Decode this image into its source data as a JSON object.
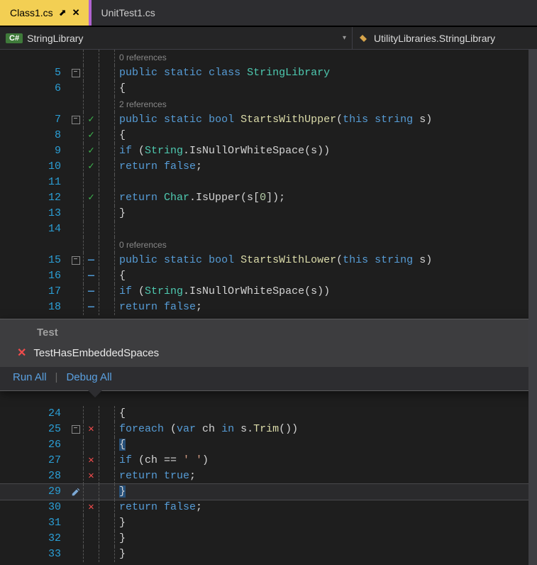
{
  "tabs": [
    {
      "label": "Class1.cs",
      "active": true,
      "pinned": true
    },
    {
      "label": "UnitTest1.cs",
      "active": false,
      "pinned": false
    }
  ],
  "breadcrumb": {
    "language_badge": "C#",
    "left": "StringLibrary",
    "right": "UtilityLibraries.StringLibrary"
  },
  "references": {
    "zero": "0 references",
    "two": "2 references"
  },
  "code": {
    "l5": "public static class StringLibrary",
    "l6": "{",
    "l7a": "public static bool ",
    "l7b": "StartsWithUpper",
    "l7c": "(this string s)",
    "l8": "{",
    "l9a": "if (",
    "l9b": "String",
    "l9c": ".IsNullOrWhiteSpace(s))",
    "l10": "return false;",
    "l12a": "return ",
    "l12b": "Char",
    "l12c": ".IsUpper(s[0]);",
    "l13": "}",
    "l15a": "public static bool ",
    "l15b": "StartsWithLower",
    "l15c": "(this string s)",
    "l16": "{",
    "l17a": "if (",
    "l17b": "String",
    "l17c": ".IsNullOrWhiteSpace(s))",
    "l18": "return false;",
    "l24": "{",
    "l25a": "foreach (var ch in s.",
    "l25b": "Trim",
    "l25c": "())",
    "l26": "{",
    "l27": "if (ch == ' ')",
    "l28": "return true;",
    "l29": "}",
    "l30": "return false;",
    "l31": "}",
    "l32": "}",
    "l33": "}"
  },
  "lines": {
    "n5": "5",
    "n6": "6",
    "n7": "7",
    "n8": "8",
    "n9": "9",
    "n10": "10",
    "n11": "11",
    "n12": "12",
    "n13": "13",
    "n14": "14",
    "n15": "15",
    "n16": "16",
    "n17": "17",
    "n18": "18",
    "n24": "24",
    "n25": "25",
    "n26": "26",
    "n27": "27",
    "n28": "28",
    "n29": "29",
    "n30": "30",
    "n31": "31",
    "n32": "32",
    "n33": "33"
  },
  "popup": {
    "header": "Test",
    "test_name": "TestHasEmbeddedSpaces",
    "run_all": "Run All",
    "debug_all": "Debug All"
  }
}
